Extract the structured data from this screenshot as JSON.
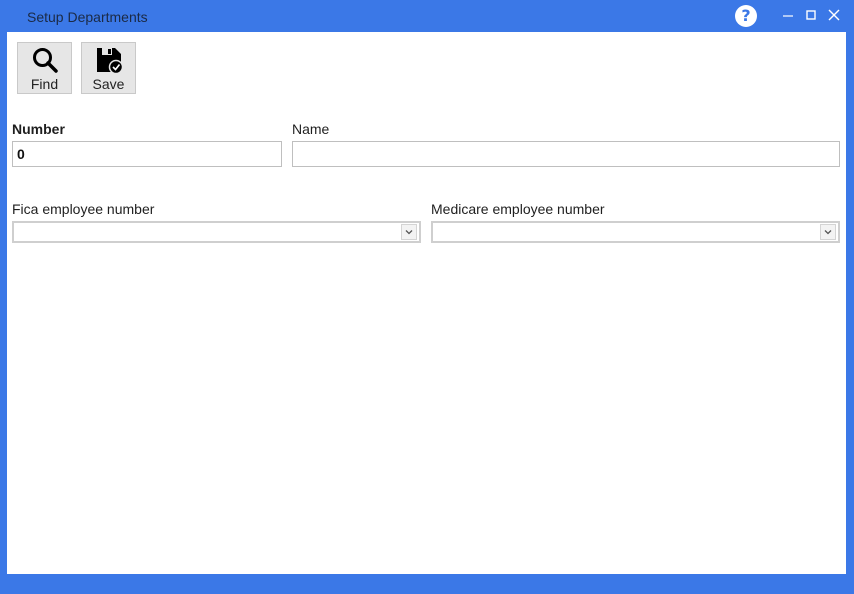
{
  "window": {
    "title": "Setup Departments"
  },
  "toolbar": {
    "find_label": "Find",
    "save_label": "Save"
  },
  "form": {
    "number_label": "Number",
    "number_value": "0",
    "name_label": "Name",
    "name_value": "",
    "fica_label": "Fica employee number",
    "fica_value": "",
    "medicare_label": "Medicare employee number",
    "medicare_value": ""
  },
  "colors": {
    "accent": "#3b78e7",
    "background": "#ffffff"
  },
  "icons": [
    "help-icon",
    "minimize-icon",
    "maximize-icon",
    "close-icon",
    "search-icon",
    "save-disk-icon",
    "chevron-down-icon"
  ]
}
